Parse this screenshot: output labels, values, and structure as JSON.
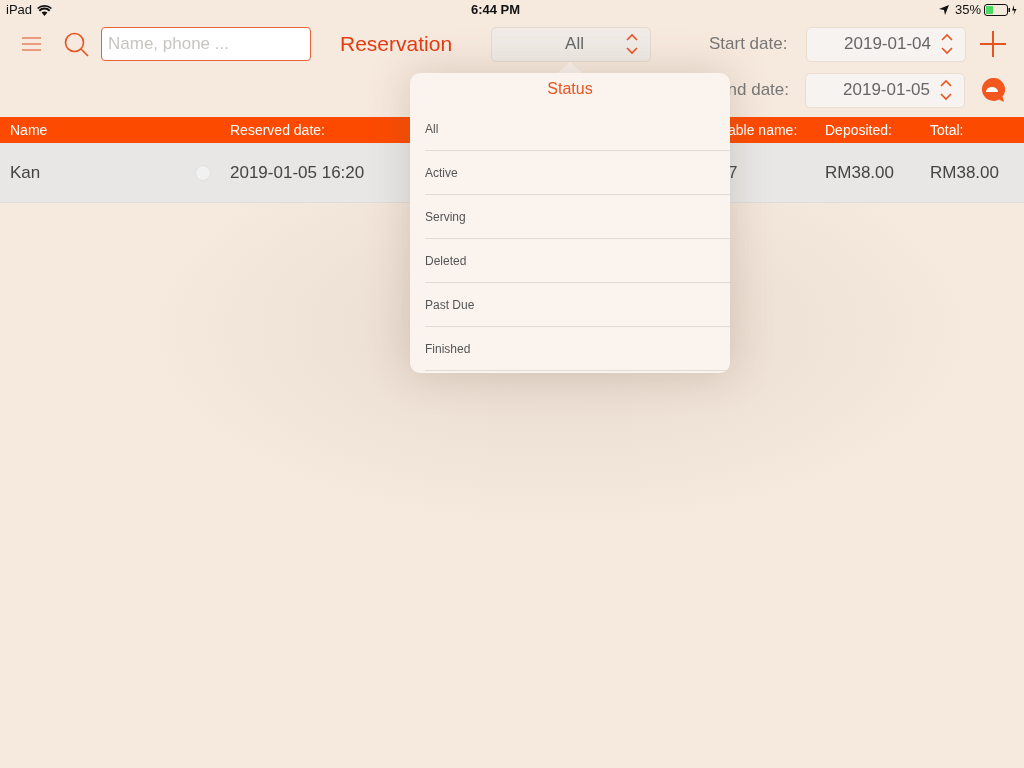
{
  "status_bar": {
    "device": "iPad",
    "time": "6:44 PM",
    "battery": "35%"
  },
  "toolbar": {
    "search": {
      "placeholder": "Name, phone ..."
    },
    "title": "Reservation",
    "status_select": {
      "value": "All"
    },
    "start_date": {
      "label": "Start date:",
      "value": "2019-01-04"
    },
    "end_date": {
      "label": "nd date:",
      "value": "2019-01-05"
    }
  },
  "table": {
    "columns": [
      {
        "label": "Name"
      },
      {
        "label": "Reserved date:"
      },
      {
        "label": "able name:"
      },
      {
        "label": "Deposited:"
      },
      {
        "label": "Total:"
      }
    ],
    "rows": [
      {
        "name": "Kan",
        "selected": false,
        "reserved_date": "2019-01-05 16:20",
        "table_name": "7",
        "deposited": "RM38.00",
        "total": "RM38.00"
      }
    ]
  },
  "status_popover": {
    "title": "Status",
    "options": [
      {
        "label": "All"
      },
      {
        "label": "Active"
      },
      {
        "label": "Serving"
      },
      {
        "label": "Deleted"
      },
      {
        "label": "Past Due"
      },
      {
        "label": "Finished"
      }
    ]
  }
}
